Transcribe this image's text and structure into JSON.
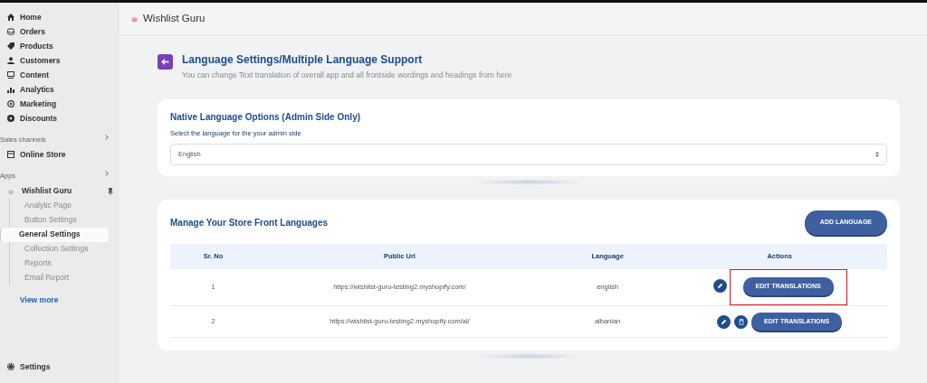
{
  "sidebar": {
    "items": [
      {
        "label": "Home"
      },
      {
        "label": "Orders"
      },
      {
        "label": "Products"
      },
      {
        "label": "Customers"
      },
      {
        "label": "Content"
      },
      {
        "label": "Analytics"
      },
      {
        "label": "Marketing"
      },
      {
        "label": "Discounts"
      }
    ],
    "sales_channels": {
      "title": "Sales channels",
      "items": [
        {
          "label": "Online Store"
        }
      ]
    },
    "apps": {
      "title": "Apps",
      "app": {
        "label": "Wishlist Guru",
        "children": [
          {
            "label": "Analytic Page",
            "selected": false
          },
          {
            "label": "Button Settings",
            "selected": false
          },
          {
            "label": "General Settings",
            "selected": true
          },
          {
            "label": "Collection Settings",
            "selected": false
          },
          {
            "label": "Reports",
            "selected": false
          },
          {
            "label": "Email Report",
            "selected": false
          }
        ]
      },
      "view_more": "View more"
    },
    "settings": "Settings"
  },
  "topbar": {
    "title": "Wishlist Guru"
  },
  "header": {
    "title": "Language Settings/Multiple Language Support",
    "subtitle": "You can change Text translation of overall app and all frontside wordings and headings from here"
  },
  "native": {
    "title": "Native Language Options (Admin Side Only)",
    "label": "Select the language for the your admin side",
    "value": "English"
  },
  "store": {
    "title": "Manage Your Store Front Languages",
    "add_button": "ADD LANGUAGE",
    "columns": [
      "Sr. No",
      "Public Url",
      "Language",
      "Actions"
    ],
    "rows": [
      {
        "no": "1",
        "url": "https://wishlist-guru-testing2.myshopify.com/",
        "language": "english",
        "deletable": false,
        "highlighted": true,
        "action": "EDIT TRANSLATIONS"
      },
      {
        "no": "2",
        "url": "https://wishlist-guru-testing2.myshopify.com/al/",
        "language": "albanian",
        "deletable": true,
        "highlighted": false,
        "action": "EDIT TRANSLATIONS"
      }
    ]
  }
}
